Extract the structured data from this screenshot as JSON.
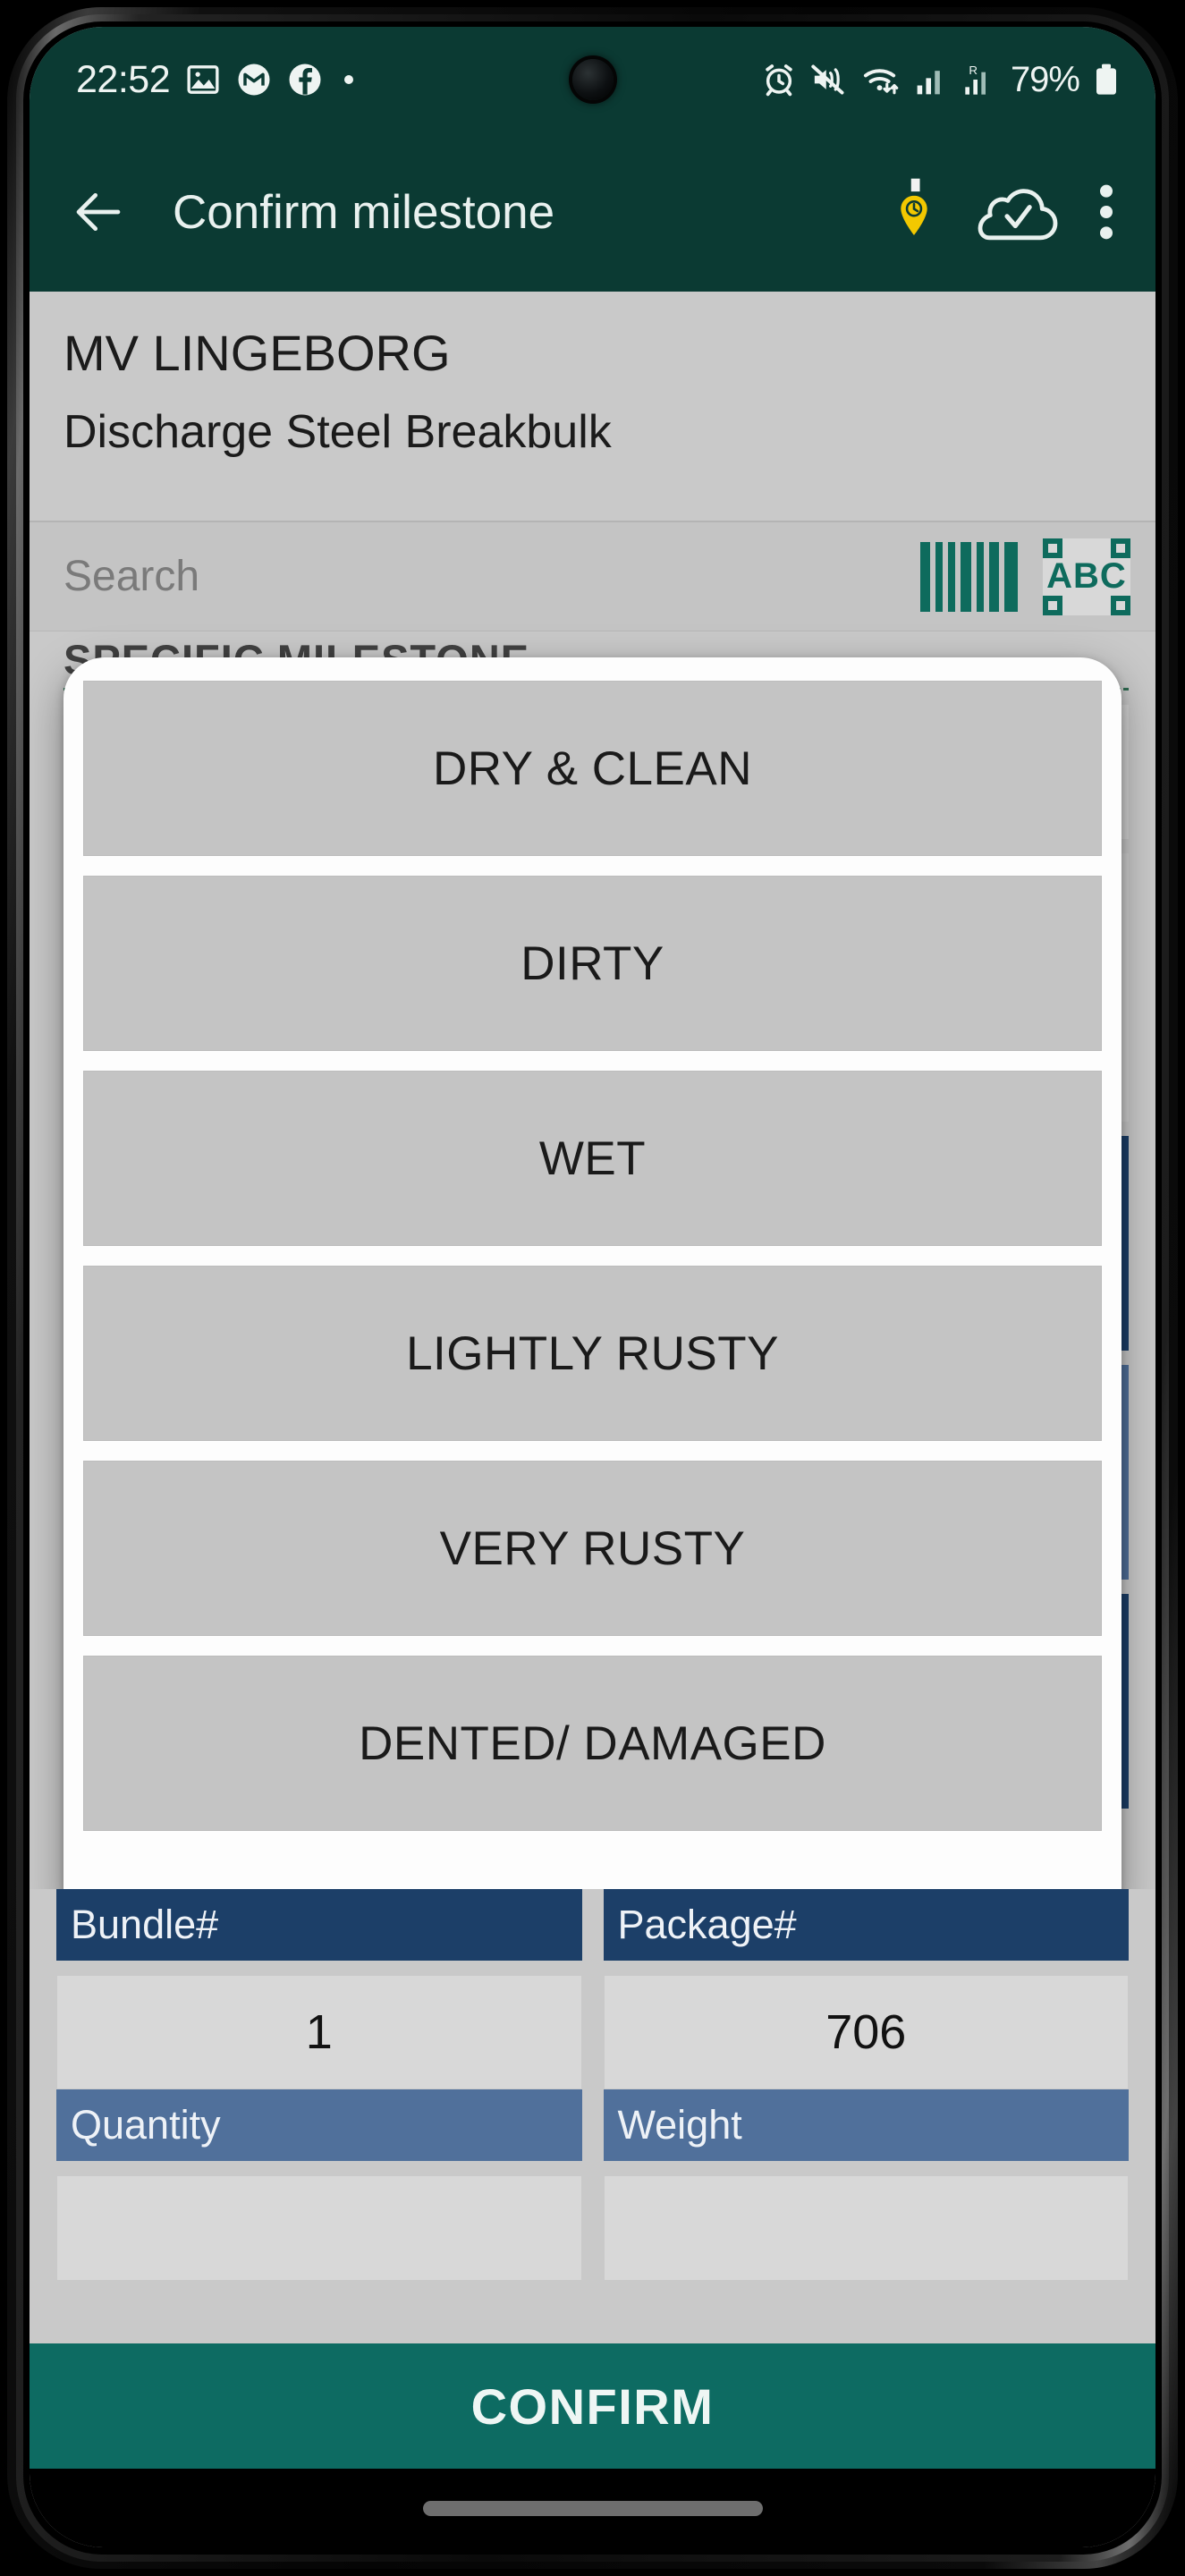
{
  "status_bar": {
    "time": "22:52",
    "battery_percent": "79%",
    "left_icons": [
      "photos-icon",
      "gmail-icon",
      "facebook-icon",
      "dot-icon"
    ],
    "right_icons": [
      "alarm-icon",
      "mute-vibrate-icon",
      "wifi-icon",
      "signal-icon",
      "roaming-signal-icon",
      "battery-icon"
    ]
  },
  "app_bar": {
    "back_label": "back-arrow",
    "title": "Confirm milestone",
    "actions": [
      "pin-clock-icon",
      "cloud-check-icon",
      "overflow-menu-icon"
    ]
  },
  "header": {
    "vessel_name": "MV LINGEBORG",
    "operation": "Discharge Steel Breakbulk"
  },
  "search": {
    "placeholder": "Search",
    "barcode_icon": "barcode-scan-icon",
    "ocr_icon": "abc-ocr-icon",
    "ocr_label": "ABC"
  },
  "background_list": {
    "section_title": "SPECIFIC MILESTONE",
    "accent_colors": [
      "#8c7018",
      "#1c3f68",
      "#50709b",
      "#1c3f68",
      "#1c3f68"
    ]
  },
  "dialog": {
    "options": [
      "DRY & CLEAN",
      "DIRTY",
      "WET",
      "LIGHTLY RUSTY",
      "VERY RUSTY",
      "DENTED/ DAMAGED"
    ]
  },
  "form": {
    "row1": [
      {
        "label": "Bundle#",
        "value": ""
      },
      {
        "label": "Package#",
        "value": ""
      }
    ],
    "row1_values": [
      "1",
      "706"
    ],
    "row2": [
      {
        "label": "Quantity",
        "value": ""
      },
      {
        "label": "Weight",
        "value": ""
      }
    ]
  },
  "confirm_button": {
    "label": "CONFIRM"
  },
  "colors": {
    "brand_green": "#0b3a33",
    "confirm_green": "#0d6b62",
    "header_blue": "#1c3f68",
    "subheader_blue": "#50709b",
    "accent_yellow": "#f2c800",
    "scan_teal": "#0e6b5d"
  }
}
